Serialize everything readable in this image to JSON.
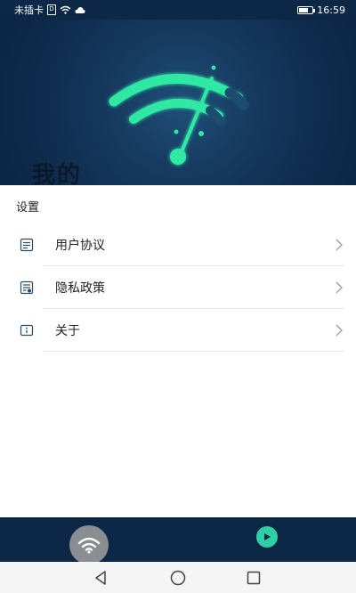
{
  "status_bar": {
    "carrier": "未插卡",
    "sim_badge": "D",
    "time": "16:59",
    "battery_level": 0.7
  },
  "header": {
    "title": "我的",
    "background_color": "#0f2c4e",
    "logo_color": "#2ee8a4"
  },
  "settings": {
    "section_label": "设置",
    "items": [
      {
        "label": "用户协议",
        "icon": "document-icon"
      },
      {
        "label": "隐私政策",
        "icon": "privacy-document-icon"
      },
      {
        "label": "关于",
        "icon": "info-icon"
      }
    ]
  },
  "tab_bar": {
    "background_color": "#0d2746",
    "tabs": [
      {
        "icon": "wifi-icon",
        "active": true
      },
      {
        "icon": "play-icon",
        "active": false
      }
    ]
  },
  "nav_bar": {
    "buttons": [
      "back-icon",
      "home-icon",
      "recents-icon"
    ]
  }
}
